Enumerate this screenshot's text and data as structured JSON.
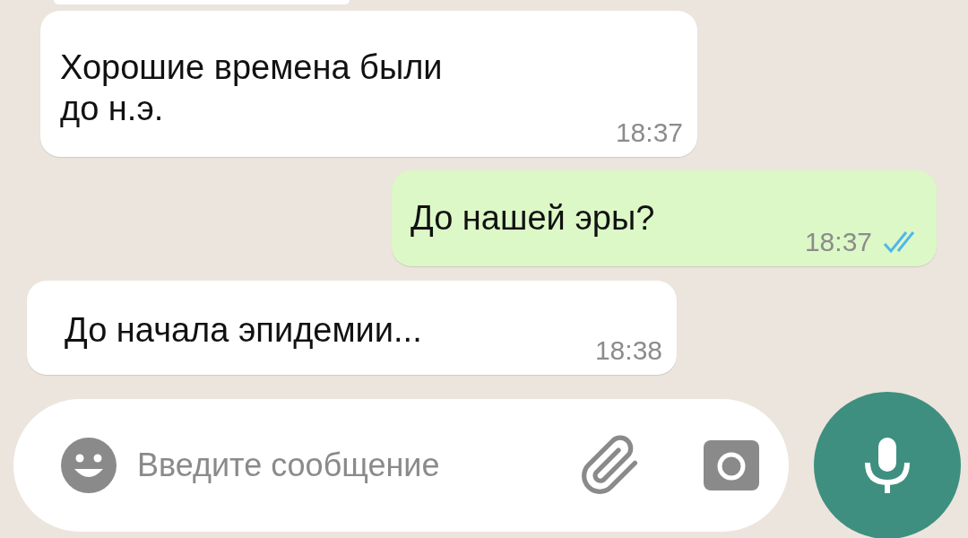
{
  "messages": [
    {
      "kind": "incoming",
      "text": "Хорошие времена были\nдо н.э.",
      "time": "18:37"
    },
    {
      "kind": "outgoing",
      "text": "До нашей эры?",
      "time": "18:37",
      "read": true
    },
    {
      "kind": "incoming",
      "text": "До начала эпидемии...",
      "time": "18:38"
    }
  ],
  "composer": {
    "placeholder": "Введите сообщение"
  }
}
